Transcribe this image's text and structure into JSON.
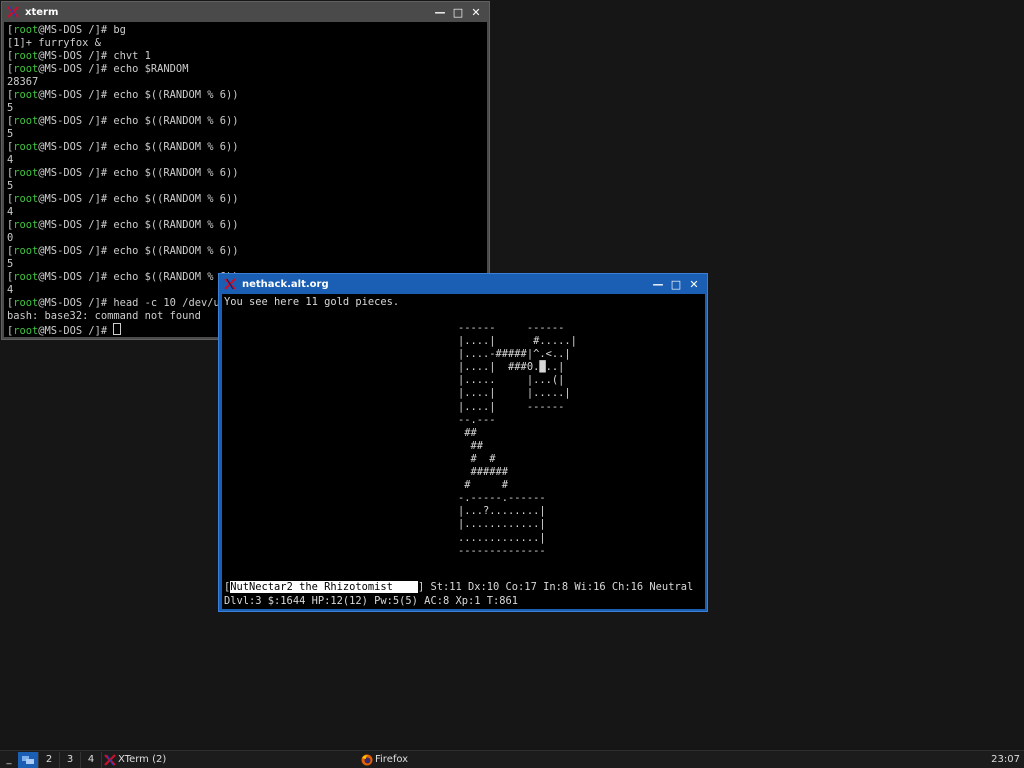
{
  "xterm": {
    "title": "xterm",
    "lines": [
      {
        "prompt": true,
        "cmd": "bg"
      },
      {
        "prompt": false,
        "out": "[1]+ furryfox &"
      },
      {
        "prompt": true,
        "cmd": "chvt 1"
      },
      {
        "prompt": true,
        "cmd": "echo $RANDOM"
      },
      {
        "prompt": false,
        "out": "28367"
      },
      {
        "prompt": true,
        "cmd": "echo $((RANDOM % 6))"
      },
      {
        "prompt": false,
        "out": "5"
      },
      {
        "prompt": true,
        "cmd": "echo $((RANDOM % 6))"
      },
      {
        "prompt": false,
        "out": "5"
      },
      {
        "prompt": true,
        "cmd": "echo $((RANDOM % 6))"
      },
      {
        "prompt": false,
        "out": "4"
      },
      {
        "prompt": true,
        "cmd": "echo $((RANDOM % 6))"
      },
      {
        "prompt": false,
        "out": "5"
      },
      {
        "prompt": true,
        "cmd": "echo $((RANDOM % 6))"
      },
      {
        "prompt": false,
        "out": "4"
      },
      {
        "prompt": true,
        "cmd": "echo $((RANDOM % 6))"
      },
      {
        "prompt": false,
        "out": "0"
      },
      {
        "prompt": true,
        "cmd": "echo $((RANDOM % 6))"
      },
      {
        "prompt": false,
        "out": "5"
      },
      {
        "prompt": true,
        "cmd": "echo $((RANDOM % 6))"
      },
      {
        "prompt": false,
        "out": "4"
      },
      {
        "prompt": true,
        "cmd": "head -c 10 /dev/urandom | base32"
      },
      {
        "prompt": false,
        "out": "bash: base32: command not found"
      },
      {
        "prompt": true,
        "cmd": "",
        "cursor": true
      }
    ],
    "prompt_open": "[",
    "prompt_user": "root",
    "prompt_rest": "@MS-DOS /]# "
  },
  "nethack": {
    "title": "nethack.alt.org",
    "message": "You see here 11 gold pieces.",
    "map": [
      "------     ------",
      "|....|      #.....|",
      "|....-#####|^.<..|",
      "|....|  ###0.█..|",
      "|.....     |...(|",
      "|....|     |.....|",
      "|....|     ------",
      "--.---",
      " ##",
      "  ##",
      "  #  #",
      "  ######",
      " #     #",
      "-.-----.------",
      "|...?........|",
      "|............|",
      ".............|",
      "--------------"
    ],
    "status_name": "NutNectar2 the Rhizotomist",
    "status_line1_rest": " St:11 Dx:10 Co:17 In:8 Wi:16 Ch:16 Neutral",
    "status_line2": "Dlvl:3 $:1644 HP:12(12) Pw:5(5) AC:8 Xp:1 T:861"
  },
  "window_buttons": {
    "minimize": "—",
    "maximize": "□",
    "close": "✕"
  },
  "taskbar": {
    "workspaces": [
      "1",
      "2",
      "3",
      "4"
    ],
    "tasks": [
      {
        "label": "XTerm (2)",
        "icon": "x-icon"
      },
      {
        "label": "Firefox",
        "icon": "firefox-icon"
      }
    ],
    "clock": "23:07",
    "desktop_label": "_"
  },
  "colors": {
    "accent": "#1a5fb4",
    "prompt_user": "#3ec43e",
    "xterm_titlebar": "#4a4a4a"
  }
}
